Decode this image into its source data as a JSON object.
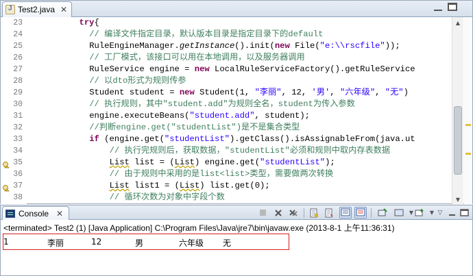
{
  "editor": {
    "tab_title": "Test2.java",
    "tab_close": "✕",
    "lines": [
      {
        "n": "23",
        "indent": 5,
        "parts": [
          [
            "kw",
            "try"
          ],
          [
            "",
            "{"
          ]
        ]
      },
      {
        "n": "24",
        "indent": 6,
        "parts": [
          [
            "cm",
            "// 编译文件指定目录，默认版本目录是指定目录下的default"
          ]
        ]
      },
      {
        "n": "25",
        "indent": 6,
        "parts": [
          [
            "",
            "RuleEngineManager."
          ],
          [
            "it",
            "getInstance"
          ],
          [
            "",
            "().init("
          ],
          [
            "kw",
            "new"
          ],
          [
            "",
            " File("
          ],
          [
            "st",
            "\"e:\\\\rscfile\""
          ],
          [
            "",
            "));"
          ]
        ]
      },
      {
        "n": "26",
        "indent": 6,
        "parts": [
          [
            "cm",
            "// 工厂模式，该接口可以用在本地调用，以及服务器调用"
          ]
        ]
      },
      {
        "n": "27",
        "indent": 6,
        "parts": [
          [
            "",
            "RuleService engine = "
          ],
          [
            "kw",
            "new"
          ],
          [
            "",
            " LocalRuleServiceFactory().getRuleService"
          ]
        ]
      },
      {
        "n": "28",
        "indent": 6,
        "parts": [
          [
            "cm",
            "// 以dto形式为规则传参"
          ]
        ]
      },
      {
        "n": "29",
        "indent": 6,
        "parts": [
          [
            "",
            "Student student = "
          ],
          [
            "kw",
            "new"
          ],
          [
            "",
            " Student(1, "
          ],
          [
            "st",
            "\"李丽\""
          ],
          [
            "",
            ", 12, "
          ],
          [
            "st",
            "'男'"
          ],
          [
            "",
            ", "
          ],
          [
            "st",
            "\"六年级\""
          ],
          [
            "",
            ", "
          ],
          [
            "st",
            "\"无\""
          ],
          [
            "",
            ")"
          ]
        ]
      },
      {
        "n": "30",
        "indent": 6,
        "parts": [
          [
            "cm",
            "// 执行规则，其中\"student.add\"为规则全名，student为传入参数"
          ]
        ]
      },
      {
        "n": "31",
        "indent": 6,
        "parts": [
          [
            "",
            "engine.executeBeans("
          ],
          [
            "st",
            "\"student.add\""
          ],
          [
            "",
            ", student);"
          ]
        ]
      },
      {
        "n": "32",
        "indent": 6,
        "parts": [
          [
            "cm",
            "//判断engine.get(\"studentList\")是不是集合类型"
          ]
        ]
      },
      {
        "n": "33",
        "indent": 6,
        "parts": [
          [
            "kw",
            "if"
          ],
          [
            "",
            " (engine.get("
          ],
          [
            "st",
            "\"studentList\""
          ],
          [
            "",
            ").getClass().isAssignableFrom(java.ut"
          ]
        ]
      },
      {
        "n": "34",
        "indent": 8,
        "parts": [
          [
            "cm",
            "// 执行完规则后，获取数据，\"studentList\"必须和规则中取内存表数据"
          ]
        ]
      },
      {
        "n": "35",
        "indent": 8,
        "parts": [
          [
            "wv",
            "List"
          ],
          [
            "",
            " list = ("
          ],
          [
            "wv",
            "List"
          ],
          [
            "",
            ") engine.get("
          ],
          [
            "st",
            "\"studentList\""
          ],
          [
            "",
            ");"
          ]
        ]
      },
      {
        "n": "36",
        "indent": 8,
        "parts": [
          [
            "cm",
            "// 由于规则中采用的是list<list>类型，需要做两次转换"
          ]
        ]
      },
      {
        "n": "37",
        "indent": 8,
        "parts": [
          [
            "wv",
            "List"
          ],
          [
            "",
            " list1 = ("
          ],
          [
            "wv",
            "List"
          ],
          [
            "",
            ") list.get(0);"
          ]
        ]
      },
      {
        "n": "38",
        "indent": 8,
        "parts": [
          [
            "cm",
            "// 循环次数为对象中字段个数"
          ]
        ]
      }
    ]
  },
  "console": {
    "tab_title": "Console",
    "tab_close": "✕",
    "status": "<terminated> Test2 (1) [Java Application] C:\\Program Files\\Java\\jre7\\bin\\javaw.exe (2013-8-1 上午11:36:31)",
    "output": [
      "1",
      "李丽",
      "12",
      "男",
      "六年级",
      "无"
    ]
  },
  "toolbar_icons": [
    "terminate-icon",
    "remove-launch-icon",
    "remove-all-terminated-icon",
    "scroll-lock-icon",
    "word-wrap-icon",
    "show-on-output-icon",
    "show-on-error-icon",
    "pin-console-icon",
    "display-selected-console-icon",
    "open-console-icon",
    "view-menu-icon",
    "minimize-icon",
    "maximize-icon"
  ]
}
